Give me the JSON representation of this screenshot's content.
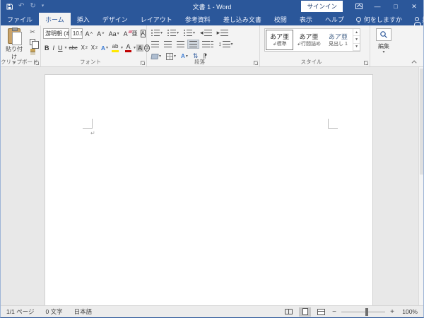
{
  "titlebar": {
    "title": "文書 1 - Word",
    "sign_in": "サインイン",
    "minimize": "—",
    "maximize": "□",
    "close": "✕"
  },
  "tabs": {
    "file": "ファイル",
    "home": "ホーム",
    "insert": "挿入",
    "design": "デザイン",
    "layout": "レイアウト",
    "references": "参考資料",
    "mailings": "差し込み文書",
    "review": "校閲",
    "view": "表示",
    "help": "ヘルプ",
    "tell_me": "何をしますか",
    "share": "共有"
  },
  "ribbon": {
    "clipboard": {
      "label": "クリップボード",
      "paste": "貼り付け",
      "cut_glyph": "✂"
    },
    "font": {
      "label": "フォント",
      "font_name": "游明朝 (本文のフ",
      "font_size": "10.5",
      "grow": "A",
      "shrink": "A",
      "change_case": "Aa",
      "clear_format": "A",
      "ruby": "亜",
      "border_a": "A",
      "bold": "B",
      "italic": "I",
      "underline": "U",
      "strike": "abc",
      "subscript": "X",
      "superscript": "X",
      "effects_a": "A",
      "highlight": "ab",
      "font_color_a": "A",
      "shading_a": "A",
      "enclose": "字"
    },
    "paragraph": {
      "label": "段落",
      "sort_glyph": "⇅",
      "pilcrow_glyph": "⁋",
      "spacing_glyph": "↕",
      "indent_out": "◂",
      "indent_in": "▸"
    },
    "styles": {
      "label": "スタイル",
      "items": [
        {
          "preview": "あア亜",
          "mark": "↲",
          "name": "標準"
        },
        {
          "preview": "あア亜",
          "mark": "↲",
          "name": "行間詰め"
        },
        {
          "preview": "あア亜",
          "mark": "",
          "name": "見出し 1"
        }
      ]
    },
    "editing": {
      "label": "編集"
    }
  },
  "document": {
    "pilcrow": "↵"
  },
  "statusbar": {
    "page": "1/1 ページ",
    "chars": "0 文字",
    "language": "日本語",
    "zoom_minus": "−",
    "zoom_plus": "+",
    "zoom_pct": "100%"
  },
  "colors": {
    "accent": "#2b579a",
    "ribbon_bg": "#f3f3f3",
    "doc_bg": "#e8e8e8",
    "highlight_yellow": "#ffe800",
    "font_color_red": "#c00000"
  }
}
